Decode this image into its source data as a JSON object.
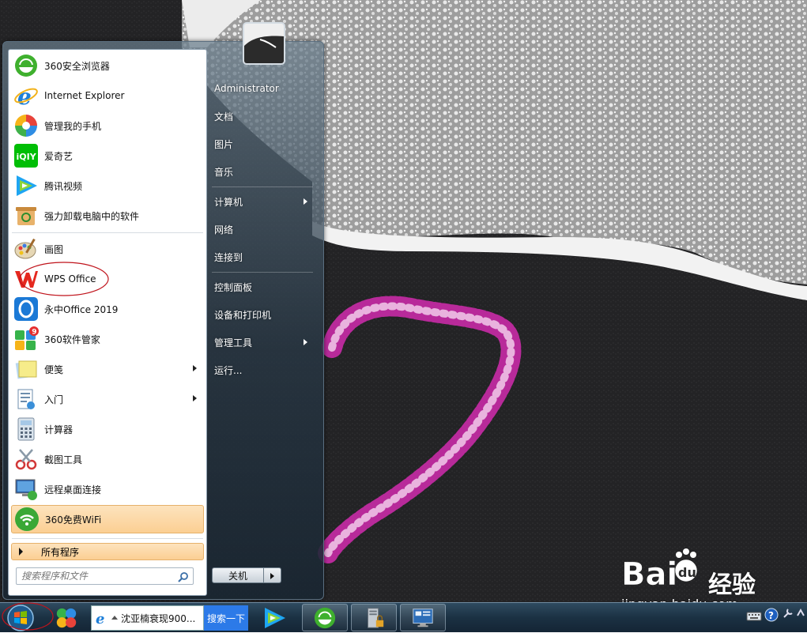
{
  "start_menu": {
    "programs": [
      {
        "label": "360安全浏览器",
        "icon": "360-browser-icon"
      },
      {
        "label": "Internet Explorer",
        "icon": "internet-explorer-icon"
      },
      {
        "label": "管理我的手机",
        "icon": "phone-manager-icon"
      },
      {
        "label": "爱奇艺",
        "icon": "iqiyi-icon"
      },
      {
        "label": "腾讯视频",
        "icon": "tencent-video-icon"
      },
      {
        "label": "强力卸载电脑中的软件",
        "icon": "uninstaller-icon"
      },
      {
        "label": "画图",
        "icon": "paint-icon"
      },
      {
        "label": "WPS Office",
        "icon": "wps-office-icon"
      },
      {
        "label": "永中Office 2019",
        "icon": "yozo-office-icon"
      },
      {
        "label": "360软件管家",
        "icon": "360-software-manager-icon",
        "badge": "9"
      },
      {
        "label": "便笺",
        "icon": "sticky-notes-icon"
      },
      {
        "label": "入门",
        "icon": "getting-started-icon"
      },
      {
        "label": "计算器",
        "icon": "calculator-icon"
      },
      {
        "label": "截图工具",
        "icon": "snipping-tool-icon"
      },
      {
        "label": "远程桌面连接",
        "icon": "remote-desktop-icon"
      },
      {
        "label": "360免费WiFi",
        "icon": "360-wifi-icon"
      }
    ],
    "all_programs_label": "所有程序",
    "search_placeholder": "搜索程序和文件",
    "right_items": [
      {
        "label": "Administrator"
      },
      {
        "label": "文档"
      },
      {
        "label": "图片"
      },
      {
        "label": "音乐"
      },
      {
        "label": "计算机"
      },
      {
        "label": "网络"
      },
      {
        "label": "连接到"
      },
      {
        "label": "控制面板"
      },
      {
        "label": "设备和打印机"
      },
      {
        "label": "管理工具"
      },
      {
        "label": "运行..."
      }
    ],
    "shutdown_label": "关机"
  },
  "taskbar": {
    "search_text": "沈亚楠衰现900...",
    "search_button": "搜索一下"
  },
  "watermark": {
    "brand_suffix": "经验",
    "url": "jingyan.baidu.com"
  },
  "colors": {
    "highlight": "#fbcf93",
    "annotation_circle": "#c0141c",
    "taskbar": "#1b3143"
  }
}
